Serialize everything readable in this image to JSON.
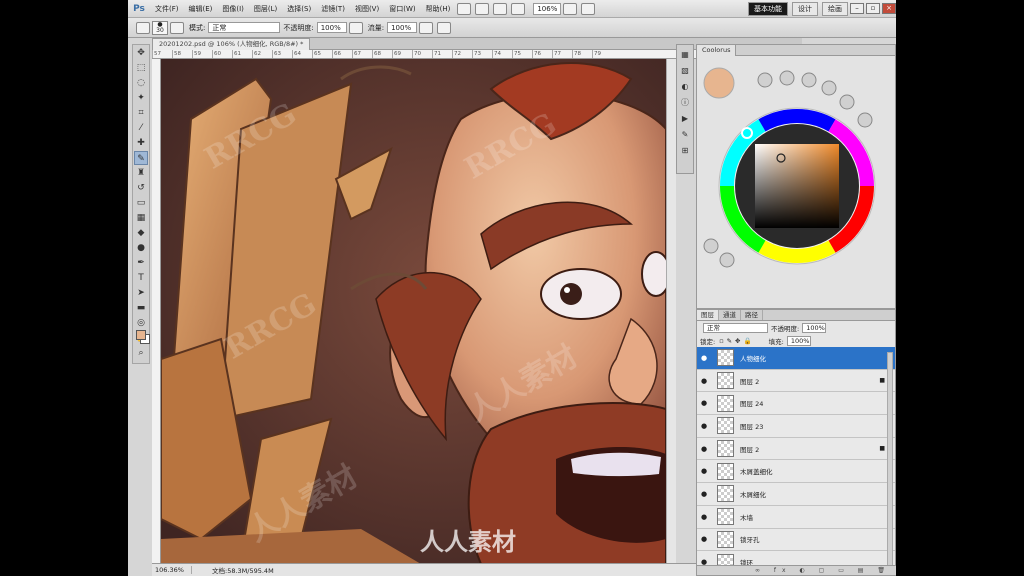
{
  "app": {
    "logo": "Ps",
    "menus": [
      "文件(F)",
      "编辑(E)",
      "图像(I)",
      "图层(L)",
      "选择(S)",
      "滤镜(T)",
      "视图(V)",
      "窗口(W)",
      "帮助(H)"
    ],
    "zoom_display": "106%",
    "workspaces": [
      "基本功能",
      "设计",
      "绘画"
    ],
    "active_workspace": "基本功能"
  },
  "options_bar": {
    "brush_size": "30",
    "mode_label": "模式:",
    "mode_value": "正常",
    "opacity_label": "不透明度:",
    "opacity_value": "100%",
    "flow_label": "流量:",
    "flow_value": "100%"
  },
  "document": {
    "tab_title": "20201202.psd @ 106% (人物细化, RGB/8#) *",
    "ruler_marks": [
      "57",
      "58",
      "59",
      "60",
      "61",
      "62",
      "63",
      "64",
      "65",
      "66",
      "67",
      "68",
      "69",
      "70",
      "71",
      "72",
      "73",
      "74",
      "75",
      "76",
      "77",
      "78",
      "79"
    ],
    "status_zoom": "106.36%",
    "status_doc": "文档:58.3M/595.4M"
  },
  "colour_panel": {
    "tab": "Coolorus",
    "fg_color": "#e7b58f"
  },
  "layers_panel": {
    "tabs": [
      "图层",
      "通道",
      "路径"
    ],
    "blend_mode": "正常",
    "opacity_label": "不透明度:",
    "opacity_value": "100%",
    "lock_label": "锁定:",
    "fill_label": "填充:",
    "fill_value": "100%",
    "layers": [
      {
        "name": "人物细化",
        "selected": true
      },
      {
        "name": "图层 2",
        "selected": false
      },
      {
        "name": "图层 24",
        "selected": false
      },
      {
        "name": "图层 23",
        "selected": false
      },
      {
        "name": "图层 2",
        "selected": false
      },
      {
        "name": "木屑盖细化",
        "selected": false
      },
      {
        "name": "木屑细化",
        "selected": false
      },
      {
        "name": "木墙",
        "selected": false
      },
      {
        "name": "锁牙孔",
        "selected": false
      },
      {
        "name": "锁环",
        "selected": false
      }
    ]
  },
  "watermarks": {
    "rrcg": "RRCG",
    "brand_cn": "人人素材"
  }
}
